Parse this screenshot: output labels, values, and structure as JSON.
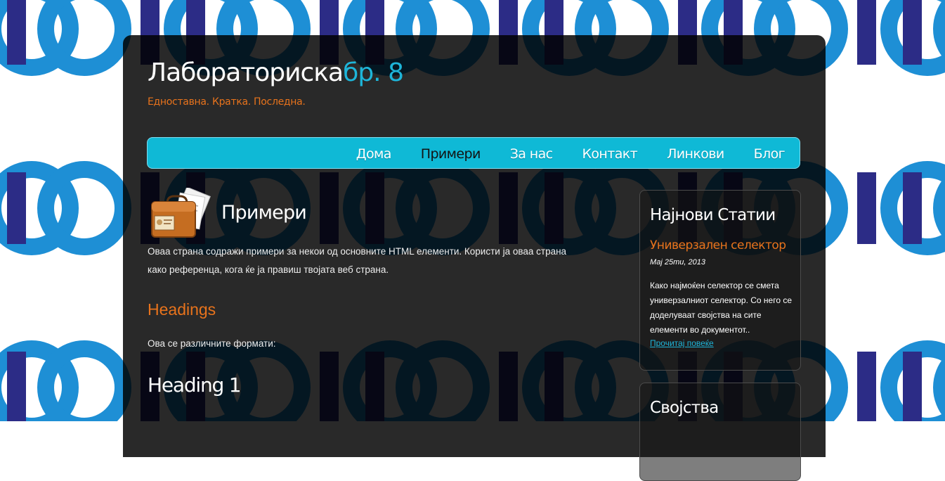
{
  "colors": {
    "accent": "#1eb5d9",
    "orange": "#e8731c",
    "nav_bg": "#0fb9d6",
    "pattern_ring": "#1e8fd5",
    "pattern_bar": "#2c2c86"
  },
  "header": {
    "title_main": "Лабораториска",
    "title_accent": "бр. 8",
    "tagline": "Едноставна. Кратка. Последна."
  },
  "nav": {
    "items": [
      {
        "label": "Дома",
        "active": false
      },
      {
        "label": "Примери",
        "active": true
      },
      {
        "label": "За нас",
        "active": false
      },
      {
        "label": "Контакт",
        "active": false
      },
      {
        "label": "Линкови",
        "active": false
      },
      {
        "label": "Блог",
        "active": false
      }
    ]
  },
  "content": {
    "icon": "briefcase-icon",
    "heading": "Примери",
    "intro": "Оваа страна содражи примери за некои од основните HTML елементи. Користи ја оваа страна како референца, кога ќе ја правиш твојата веб страна.",
    "headings_title": "Headings",
    "formats_text": "Ова се различните формати:",
    "heading_one": "Heading 1"
  },
  "sidebar": {
    "latest_title": "Најнови Статии",
    "article_title": "Универзален селектор",
    "article_date": "Мај 25ти, 2013",
    "article_body": "Како најмоќен селектор се смета универзалниот селектор. Со него се доделуваат својства на сите елементи во документот..",
    "read_more": "Прочитај повеќе",
    "props_title": "Својства"
  }
}
